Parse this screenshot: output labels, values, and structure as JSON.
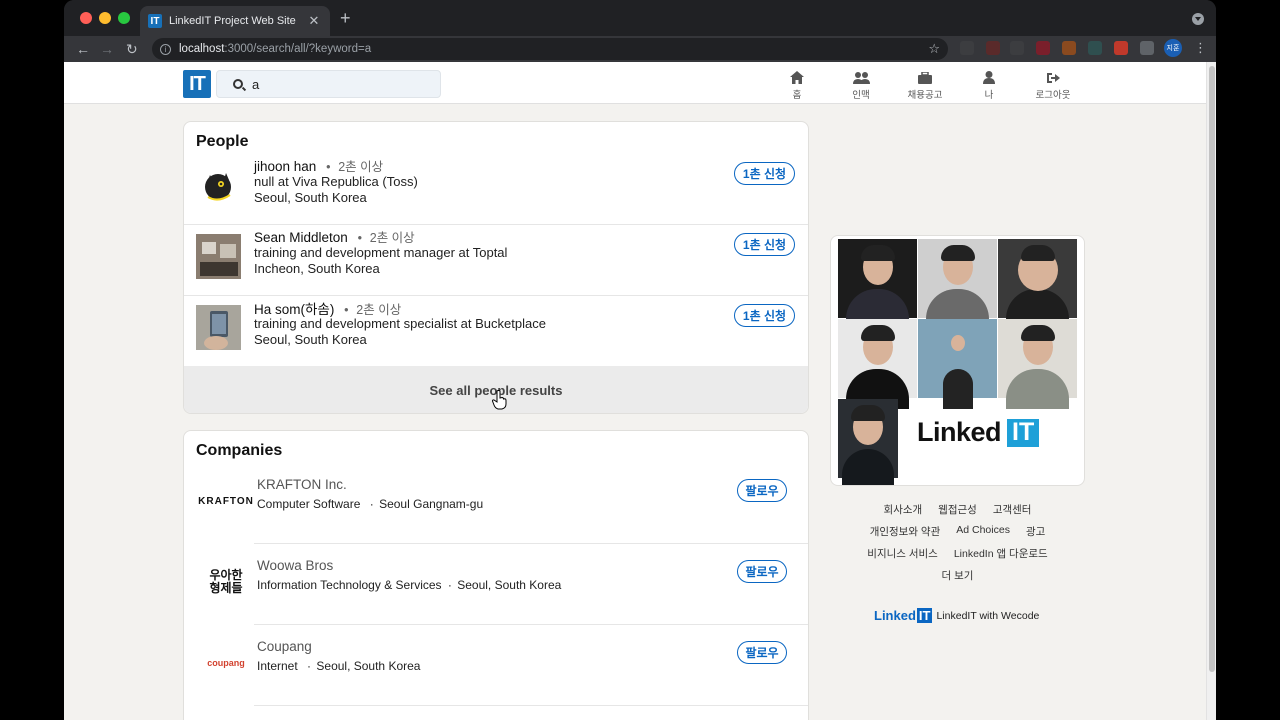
{
  "browser": {
    "tab_title": "LinkedIT Project Web Site",
    "tab_favicon": "IT",
    "tab_close": "✕",
    "new_tab": "+",
    "url_host": "localhost",
    "url_path": ":3000/search/all/?keyword=a",
    "profile": "지훈"
  },
  "header": {
    "logo": "IT",
    "search_value": "a",
    "nav": [
      {
        "label": "홈",
        "icon": "home-icon"
      },
      {
        "label": "인맥",
        "icon": "people-icon"
      },
      {
        "label": "채용공고",
        "icon": "briefcase-icon"
      },
      {
        "label": "나",
        "icon": "user-icon"
      },
      {
        "label": "로그아웃",
        "icon": "logout-icon"
      }
    ]
  },
  "people": {
    "title": "People",
    "items": [
      {
        "name": "jihoon han",
        "degree": "2촌 이상",
        "headline": "null at Viva Republica (Toss)",
        "location": "Seoul, South Korea",
        "action": "1촌 신청"
      },
      {
        "name": "Sean Middleton",
        "degree": "2촌 이상",
        "headline": "training and development manager at Toptal",
        "location": "Incheon, South Korea",
        "action": "1촌 신청"
      },
      {
        "name": "Ha som(하솜)",
        "degree": "2촌 이상",
        "headline": "training and development specialist at Bucketplace",
        "location": "Seoul, South Korea",
        "action": "1촌 신청"
      }
    ],
    "see_all": "See all people results",
    "separator": "•"
  },
  "companies": {
    "title": "Companies",
    "items": [
      {
        "name": "KRAFTON Inc.",
        "industry": "Computer Software",
        "location": "Seoul Gangnam-gu",
        "action": "팔로우",
        "logo_text": "KRAFTON"
      },
      {
        "name": "Woowa Bros",
        "industry": "Information Technology & Services",
        "location": "Seoul, South Korea",
        "action": "팔로우",
        "logo_text": "우아한 형제들"
      },
      {
        "name": "Coupang",
        "industry": "Internet",
        "location": "Seoul, South Korea",
        "action": "팔로우",
        "logo_text": "coupang"
      }
    ],
    "separator": "·"
  },
  "ad": {
    "brand_text": "Linked",
    "brand_box": "IT"
  },
  "footer": {
    "rows": [
      [
        "회사소개",
        "웹접근성",
        "고객센터"
      ],
      [
        "개인정보와 약관",
        "Ad Choices",
        "광고"
      ],
      [
        "비지니스 서비스",
        "LinkedIn 앱 다운로드"
      ],
      [
        "더 보기"
      ]
    ],
    "credit_logo": "Linked",
    "credit_logo_box": "IT",
    "credit_text": "LinkedIT with Wecode"
  },
  "colors": {
    "accent": "#0a66c2",
    "logo_blue": "#1770b8",
    "background": "#f3f2ef"
  }
}
